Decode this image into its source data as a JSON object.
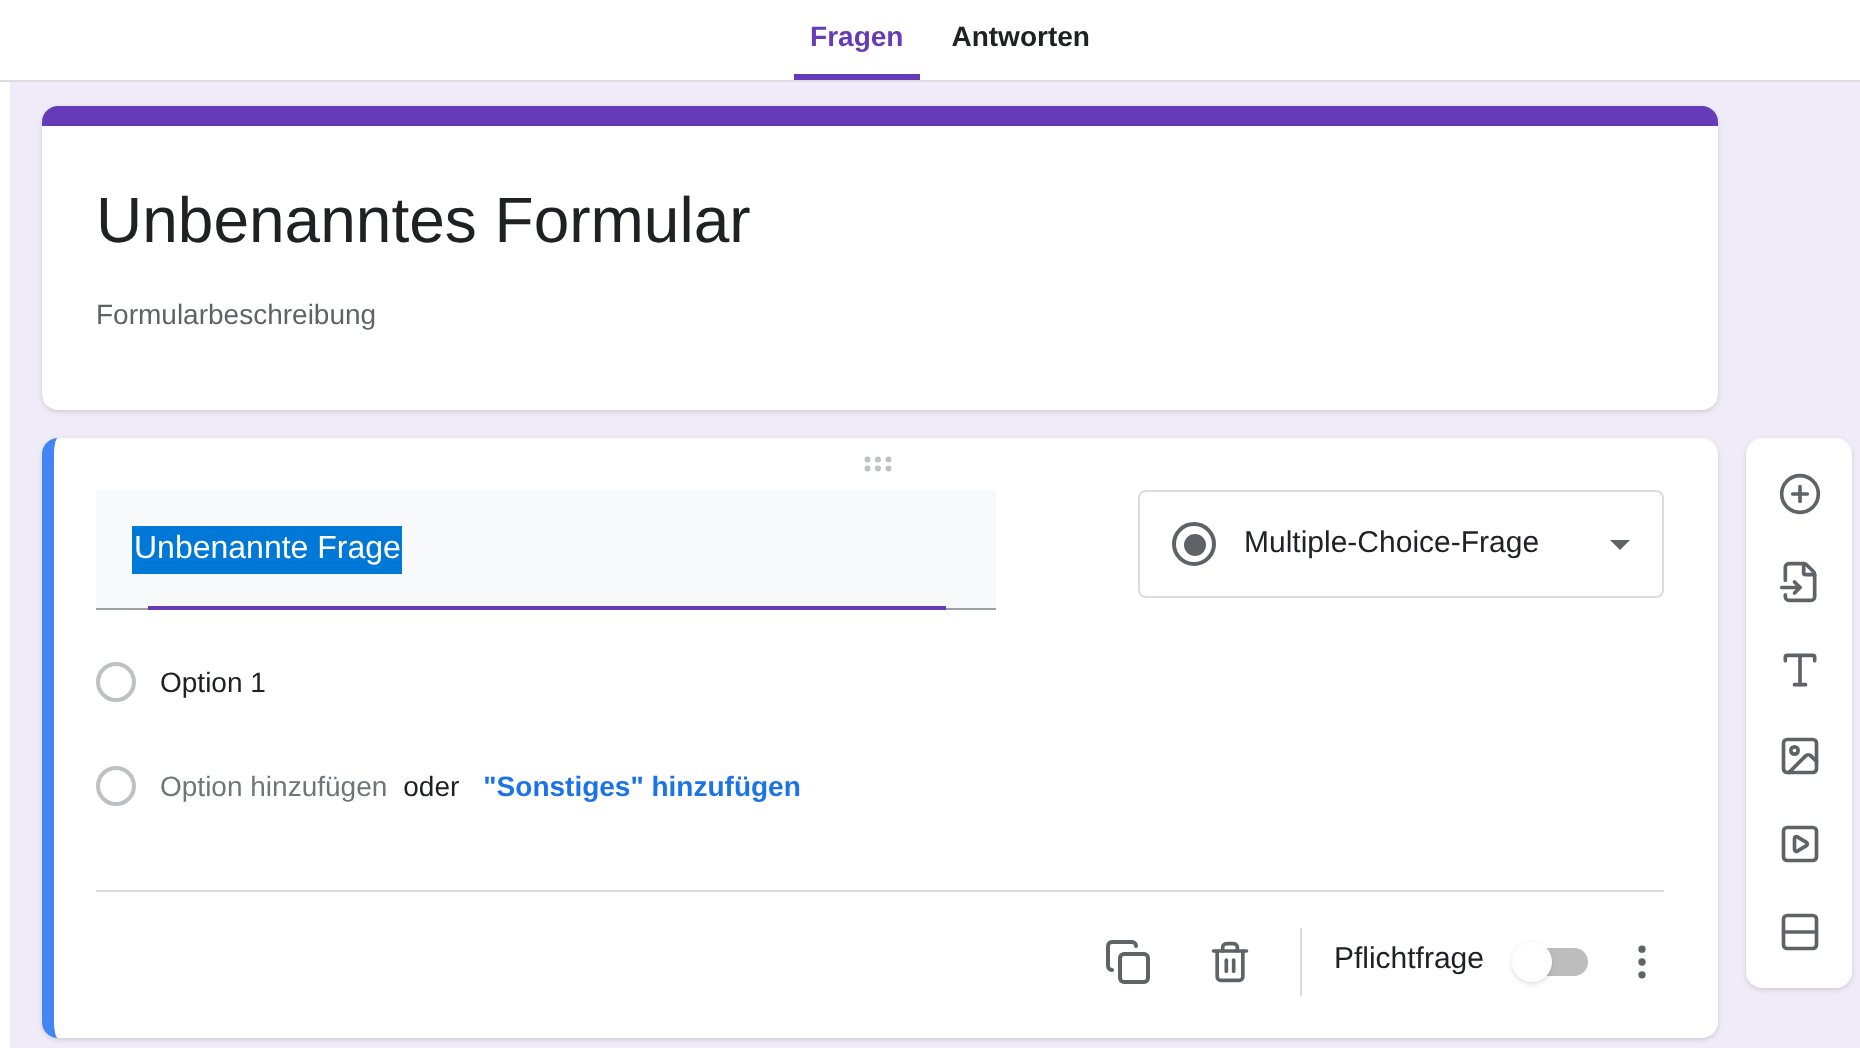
{
  "tabs": [
    {
      "label": "Fragen",
      "selected": true
    },
    {
      "label": "Antworten",
      "selected": false
    }
  ],
  "form": {
    "title": "Unbenanntes Formular",
    "description": "Formularbeschreibung"
  },
  "question": {
    "title": "Unbenannte Frage",
    "title_highlighted": true,
    "type": "Multiple-Choice-Frage",
    "options": [
      {
        "label": "Option 1"
      }
    ],
    "add_option": "Option hinzufügen",
    "or": "oder",
    "add_other": "\"Sonstiges\" hinzufügen",
    "required_label": "Pflichtfrage",
    "required": false
  }
}
